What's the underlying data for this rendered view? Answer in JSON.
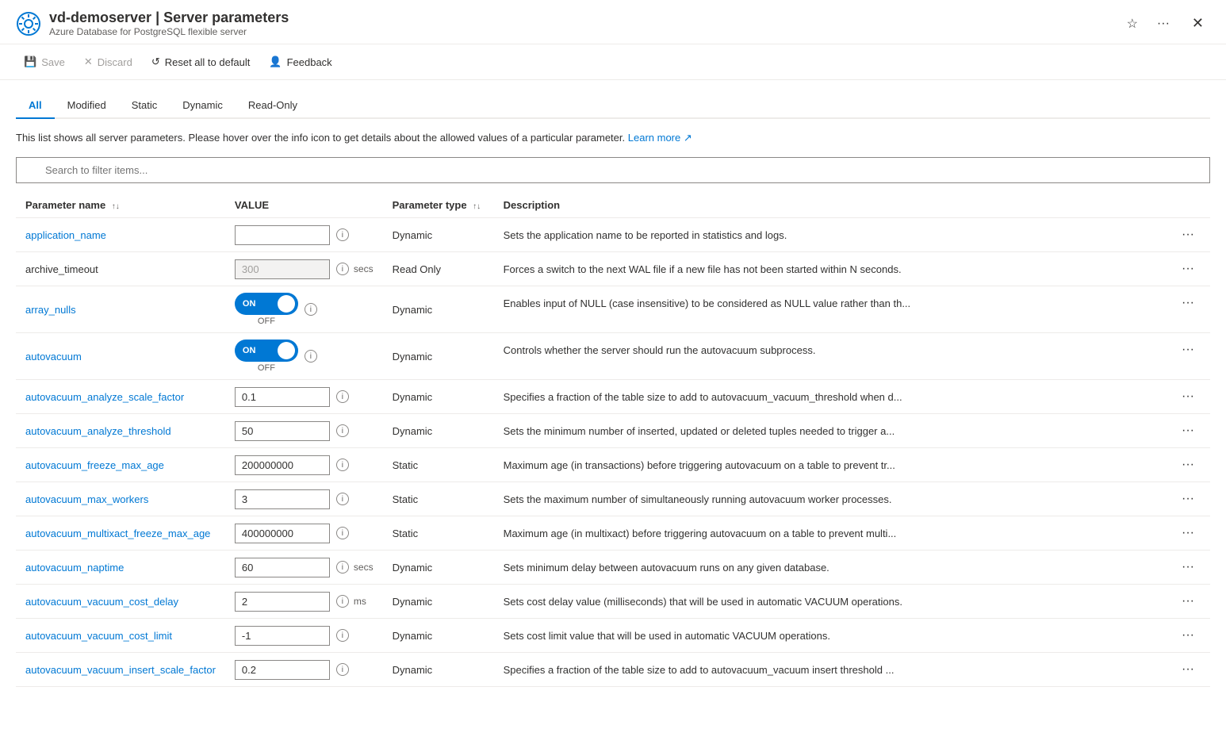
{
  "header": {
    "server_name": "vd-demoserver",
    "page_title": "Server parameters",
    "subtitle": "Azure Database for PostgreSQL flexible server"
  },
  "toolbar": {
    "save_label": "Save",
    "discard_label": "Discard",
    "reset_label": "Reset all to default",
    "feedback_label": "Feedback"
  },
  "tabs": [
    {
      "id": "all",
      "label": "All",
      "active": true
    },
    {
      "id": "modified",
      "label": "Modified",
      "active": false
    },
    {
      "id": "static",
      "label": "Static",
      "active": false
    },
    {
      "id": "dynamic",
      "label": "Dynamic",
      "active": false
    },
    {
      "id": "read-only",
      "label": "Read-Only",
      "active": false
    }
  ],
  "info_text": "This list shows all server parameters. Please hover over the info icon to get details about the allowed values of a particular parameter.",
  "learn_more": "Learn more",
  "search_placeholder": "Search to filter items...",
  "table": {
    "columns": [
      {
        "id": "name",
        "label": "Parameter name",
        "sortable": true
      },
      {
        "id": "value",
        "label": "VALUE",
        "sortable": false
      },
      {
        "id": "type",
        "label": "Parameter type",
        "sortable": true
      },
      {
        "id": "desc",
        "label": "Description",
        "sortable": false
      }
    ],
    "rows": [
      {
        "name": "application_name",
        "is_link": true,
        "value_type": "text",
        "value": "",
        "value_placeholder": "",
        "unit": "",
        "param_type": "Dynamic",
        "readonly": false,
        "description": "Sets the application name to be reported in statistics and logs."
      },
      {
        "name": "archive_timeout",
        "is_link": false,
        "value_type": "text",
        "value": "300",
        "value_placeholder": "300",
        "unit": "secs",
        "param_type": "Read Only",
        "readonly": true,
        "description": "Forces a switch to the next WAL file if a new file has not been started within N seconds."
      },
      {
        "name": "array_nulls",
        "is_link": true,
        "value_type": "toggle",
        "value": "ON",
        "unit": "",
        "param_type": "Dynamic",
        "readonly": false,
        "description": "Enables input of NULL (case insensitive) to be considered as NULL value rather than th..."
      },
      {
        "name": "autovacuum",
        "is_link": true,
        "value_type": "toggle",
        "value": "ON",
        "unit": "",
        "param_type": "Dynamic",
        "readonly": false,
        "description": "Controls whether the server should run the autovacuum subprocess."
      },
      {
        "name": "autovacuum_analyze_scale_factor",
        "is_link": true,
        "value_type": "text",
        "value": "0.1",
        "unit": "",
        "param_type": "Dynamic",
        "readonly": false,
        "description": "Specifies a fraction of the table size to add to autovacuum_vacuum_threshold when d..."
      },
      {
        "name": "autovacuum_analyze_threshold",
        "is_link": true,
        "value_type": "text",
        "value": "50",
        "unit": "",
        "param_type": "Dynamic",
        "readonly": false,
        "description": "Sets the minimum number of inserted, updated or deleted tuples needed to trigger a..."
      },
      {
        "name": "autovacuum_freeze_max_age",
        "is_link": true,
        "value_type": "text",
        "value": "200000000",
        "unit": "",
        "param_type": "Static",
        "readonly": false,
        "description": "Maximum age (in transactions) before triggering autovacuum on a table to prevent tr..."
      },
      {
        "name": "autovacuum_max_workers",
        "is_link": true,
        "value_type": "text",
        "value": "3",
        "unit": "",
        "param_type": "Static",
        "readonly": false,
        "description": "Sets the maximum number of simultaneously running autovacuum worker processes."
      },
      {
        "name": "autovacuum_multixact_freeze_max_age",
        "is_link": true,
        "value_type": "text",
        "value": "400000000",
        "unit": "",
        "param_type": "Static",
        "readonly": false,
        "description": "Maximum age (in multixact) before triggering autovacuum on a table to prevent multi..."
      },
      {
        "name": "autovacuum_naptime",
        "is_link": true,
        "value_type": "text",
        "value": "60",
        "unit": "secs",
        "param_type": "Dynamic",
        "readonly": false,
        "description": "Sets minimum delay between autovacuum runs on any given database."
      },
      {
        "name": "autovacuum_vacuum_cost_delay",
        "is_link": true,
        "value_type": "text",
        "value": "2",
        "unit": "ms",
        "param_type": "Dynamic",
        "readonly": false,
        "description": "Sets cost delay value (milliseconds) that will be used in automatic VACUUM operations."
      },
      {
        "name": "autovacuum_vacuum_cost_limit",
        "is_link": true,
        "value_type": "text",
        "value": "-1",
        "unit": "",
        "param_type": "Dynamic",
        "readonly": false,
        "description": "Sets cost limit value that will be used in automatic VACUUM operations."
      },
      {
        "name": "autovacuum_vacuum_insert_scale_factor",
        "is_link": true,
        "value_type": "text",
        "value": "0.2",
        "unit": "",
        "param_type": "Dynamic",
        "readonly": false,
        "description": "Specifies a fraction of the table size to add to autovacuum_vacuum insert threshold ..."
      }
    ]
  },
  "colors": {
    "accent": "#0078d4",
    "toggle_on": "#0078d4",
    "border": "#edebe9",
    "text_secondary": "#605e5c"
  }
}
